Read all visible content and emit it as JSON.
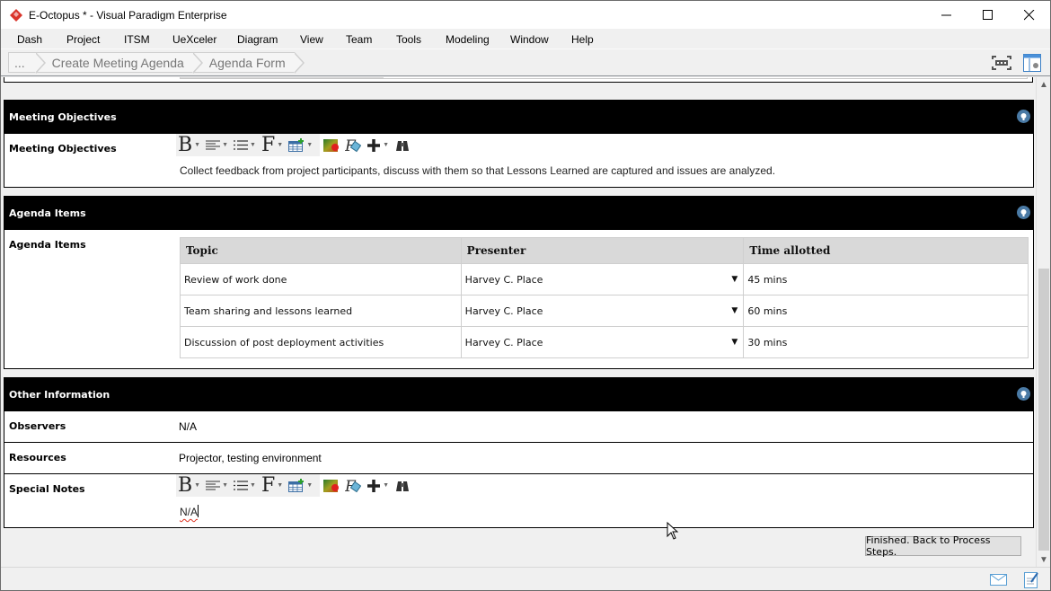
{
  "window": {
    "title": "E-Octopus * - Visual Paradigm Enterprise",
    "controls": [
      "minimize",
      "maximize",
      "close"
    ]
  },
  "menu": {
    "items": [
      "Dash",
      "Project",
      "ITSM",
      "UeXceler",
      "Diagram",
      "View",
      "Team",
      "Tools",
      "Modeling",
      "Window",
      "Help"
    ]
  },
  "breadcrumb": {
    "items": [
      "...",
      "Create Meeting Agenda",
      "Agenda Form"
    ]
  },
  "sections": {
    "objectives": {
      "header": "Meeting Objectives",
      "label": "Meeting Objectives",
      "text": "Collect feedback from project participants, discuss with them so that Lessons Learned are captured and issues are analyzed."
    },
    "agenda": {
      "header": "Agenda Items",
      "label": "Agenda Items",
      "columns": [
        "Topic",
        "Presenter",
        "Time allotted"
      ],
      "rows": [
        {
          "topic": "Review of work done",
          "presenter": "Harvey C. Place",
          "time": "45 mins"
        },
        {
          "topic": "Team sharing and lessons learned",
          "presenter": "Harvey C. Place",
          "time": "60 mins"
        },
        {
          "topic": "Discussion of post deployment activities",
          "presenter": "Harvey C. Place",
          "time": "30 mins"
        }
      ]
    },
    "other": {
      "header": "Other Information",
      "observers_label": "Observers",
      "observers_value": "N/A",
      "resources_label": "Resources",
      "resources_value": "Projector, testing environment",
      "notes_label": "Special Notes",
      "notes_value": "N/A"
    }
  },
  "toolbar": {
    "bold": "B",
    "font": "F",
    "icons": [
      "bold-icon",
      "align-icon",
      "list-icon",
      "font-icon",
      "table-icon",
      "color-icon",
      "formula-icon",
      "add-icon",
      "find-icon"
    ]
  },
  "actions": {
    "finish_label": "Finished. Back to Process Steps."
  },
  "colors": {
    "section_header_bg": "#000000",
    "pin_icon": "#4a7aa5",
    "logo": "#d9342b"
  }
}
